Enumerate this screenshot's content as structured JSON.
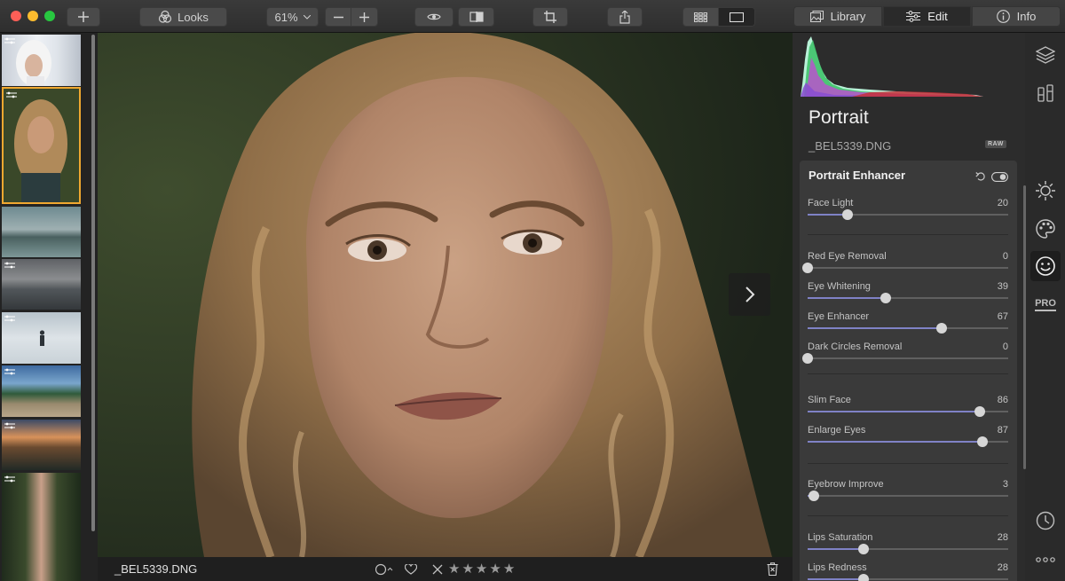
{
  "toolbar": {
    "looks_label": "Looks",
    "zoom_label": "61%",
    "tabs": [
      {
        "label": "Library"
      },
      {
        "label": "Edit"
      },
      {
        "label": "Info"
      }
    ],
    "active_tab": "Edit"
  },
  "filmstrip": {
    "thumbnails": [
      {
        "subject": "girl-in-snow-hood"
      },
      {
        "subject": "curly-haired-woman-portrait",
        "selected": true
      },
      {
        "subject": "lake-landscape"
      },
      {
        "subject": "lake-shore-people"
      },
      {
        "subject": "snowy-field-figure"
      },
      {
        "subject": "lakeside-beach"
      },
      {
        "subject": "sunset-silhouette"
      },
      {
        "subject": "forest-path"
      }
    ]
  },
  "statusbar": {
    "filename": "_BEL5339.DNG",
    "rating_stars": 0,
    "max_stars": 5
  },
  "panel": {
    "title": "Portrait",
    "filename": "_BEL5339.DNG",
    "badge": "RAW",
    "tool": {
      "title": "Portrait Enhancer",
      "sliders": [
        {
          "label": "Face Light",
          "value": "20",
          "fraction": 0.2
        },
        {
          "label": "Red Eye Removal",
          "value": "0",
          "fraction": 0.0
        },
        {
          "label": "Eye Whitening",
          "value": "39",
          "fraction": 0.39
        },
        {
          "label": "Eye Enhancer",
          "value": "67",
          "fraction": 0.67
        },
        {
          "label": "Dark Circles Removal",
          "value": "0",
          "fraction": 0.0
        },
        {
          "label": "Slim Face",
          "value": "86",
          "fraction": 0.86
        },
        {
          "label": "Enlarge Eyes",
          "value": "87",
          "fraction": 0.87
        },
        {
          "label": "Eyebrow Improve",
          "value": "3",
          "fraction": 0.03
        },
        {
          "label": "Lips Saturation",
          "value": "28",
          "fraction": 0.28
        },
        {
          "label": "Lips Redness",
          "value": "28",
          "fraction": 0.28
        }
      ]
    }
  },
  "rail": {
    "icons": [
      "layers-icon",
      "adjustment-presets-icon",
      "essentials-sun-icon",
      "creative-palette-icon",
      "portrait-face-icon",
      "pro-icon",
      "history-clock-icon",
      "more-icon"
    ],
    "active": "portrait-face-icon",
    "pro_label": "PRO"
  }
}
